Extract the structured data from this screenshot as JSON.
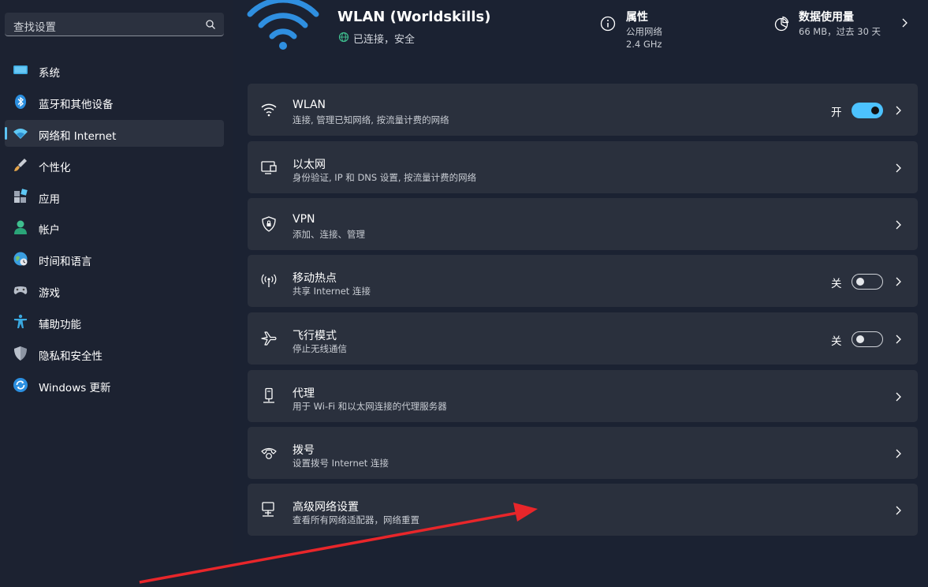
{
  "search": {
    "placeholder": "查找设置",
    "icon": "search-icon"
  },
  "sidebar": {
    "items": [
      {
        "label": "系统",
        "icon": "system-icon"
      },
      {
        "label": "蓝牙和其他设备",
        "icon": "bluetooth-icon"
      },
      {
        "label": "网络和 Internet",
        "icon": "network-icon",
        "selected": true
      },
      {
        "label": "个性化",
        "icon": "brush-icon"
      },
      {
        "label": "应用",
        "icon": "apps-icon"
      },
      {
        "label": "帐户",
        "icon": "account-icon"
      },
      {
        "label": "时间和语言",
        "icon": "time-language-icon"
      },
      {
        "label": "游戏",
        "icon": "gaming-icon"
      },
      {
        "label": "辅助功能",
        "icon": "accessibility-icon"
      },
      {
        "label": "隐私和安全性",
        "icon": "shield-icon"
      },
      {
        "label": "Windows 更新",
        "icon": "update-icon"
      }
    ]
  },
  "header": {
    "network_name": "WLAN (Worldskills)",
    "status": "已连接，安全",
    "properties": {
      "title": "属性",
      "line1": "公用网络",
      "line2": "2.4 GHz"
    },
    "data_usage": {
      "title": "数据使用量",
      "subtitle": "66 MB，过去 30 天"
    }
  },
  "cards": [
    {
      "title": "WLAN",
      "subtitle": "连接, 管理已知网络, 按流量计费的网络",
      "icon": "wifi-icon",
      "toggle": "on",
      "toggle_label": "开"
    },
    {
      "title": "以太网",
      "subtitle": "身份验证, IP 和 DNS 设置, 按流量计费的网络",
      "icon": "ethernet-icon"
    },
    {
      "title": "VPN",
      "subtitle": "添加、连接、管理",
      "icon": "vpn-shield-icon"
    },
    {
      "title": "移动热点",
      "subtitle": "共享 Internet 连接",
      "icon": "hotspot-icon",
      "toggle": "off",
      "toggle_label": "关"
    },
    {
      "title": "飞行模式",
      "subtitle": "停止无线通信",
      "icon": "airplane-icon",
      "toggle": "off",
      "toggle_label": "关"
    },
    {
      "title": "代理",
      "subtitle": "用于 Wi-Fi 和以太网连接的代理服务器",
      "icon": "proxy-icon"
    },
    {
      "title": "拨号",
      "subtitle": "设置拨号 Internet 连接",
      "icon": "dialup-icon"
    },
    {
      "title": "高级网络设置",
      "subtitle": "查看所有网络适配器，网络重置",
      "icon": "advanced-network-icon"
    }
  ],
  "colors": {
    "accent": "#4cc2ff",
    "background": "#1b2232",
    "card": "#2a303d",
    "annotation_arrow": "#e8262a"
  }
}
